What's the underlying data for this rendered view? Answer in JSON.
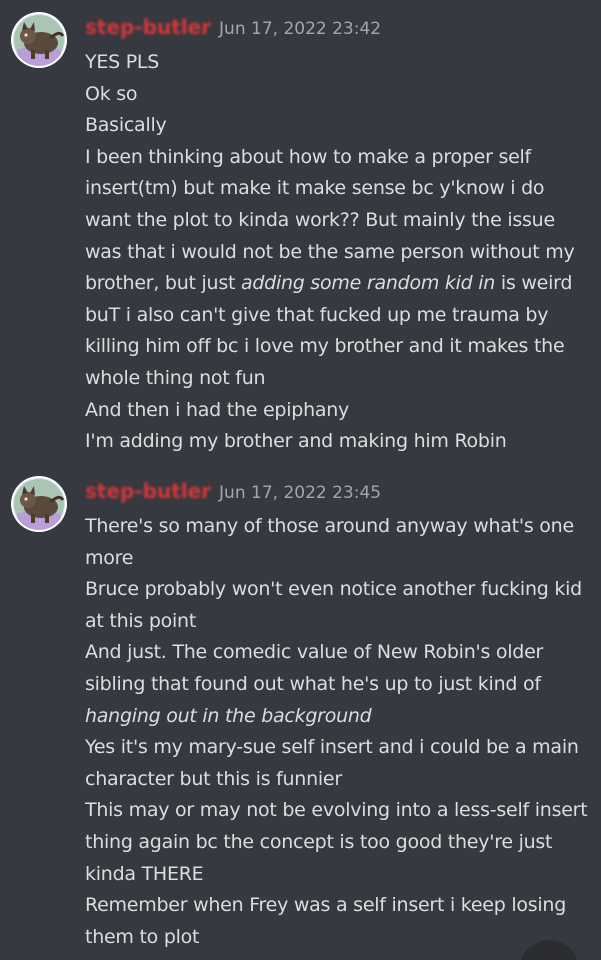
{
  "messages": [
    {
      "username": "step-butler",
      "timestamp": "Jun 17, 2022 23:42",
      "lines": [
        [
          {
            "text": "YES PLS"
          }
        ],
        [
          {
            "text": "Ok so"
          }
        ],
        [
          {
            "text": "Basically"
          }
        ],
        [
          {
            "text": "I been thinking about how to make a proper self insert(tm) but make it make sense bc y'know i do want the plot to kinda work?? But mainly the issue was that i would not be the same person without my brother, but just "
          },
          {
            "text": "adding some random kid in",
            "italic": true
          },
          {
            "text": " is weird buT i also can't give that fucked up me trauma by killing him off bc i love my brother and it makes the whole thing not fun"
          }
        ],
        [
          {
            "text": "And then i had the epiphany"
          }
        ],
        [
          {
            "text": "I'm adding my brother and making him Robin"
          }
        ]
      ]
    },
    {
      "username": "step-butler",
      "timestamp": "Jun 17, 2022 23:45",
      "lines": [
        [
          {
            "text": "There's so many of those around anyway what's one more"
          }
        ],
        [
          {
            "text": "Bruce probably won't even notice another fucking kid at this point"
          }
        ],
        [
          {
            "text": "And just. The comedic value of New Robin's older sibling that found out what he's up to just kind of "
          },
          {
            "text": "hanging out in the background",
            "italic": true
          }
        ],
        [
          {
            "text": "Yes it's my mary-sue self insert and i could be a main character but this is funnier"
          }
        ],
        [
          {
            "text": "This may or may not be evolving into a less-self insert thing again bc the concept is too good they're just kinda THERE"
          }
        ],
        [
          {
            "text": "Remember when Frey was a self insert i keep losing them to plot"
          }
        ]
      ]
    }
  ],
  "avatar_icon": "cat-avatar-icon",
  "jump_button_icon": "jump-to-present-icon",
  "colors": {
    "background": "#36393f",
    "username": "#d4373a",
    "timestamp": "#a3a6aa",
    "text": "#dcddde"
  }
}
